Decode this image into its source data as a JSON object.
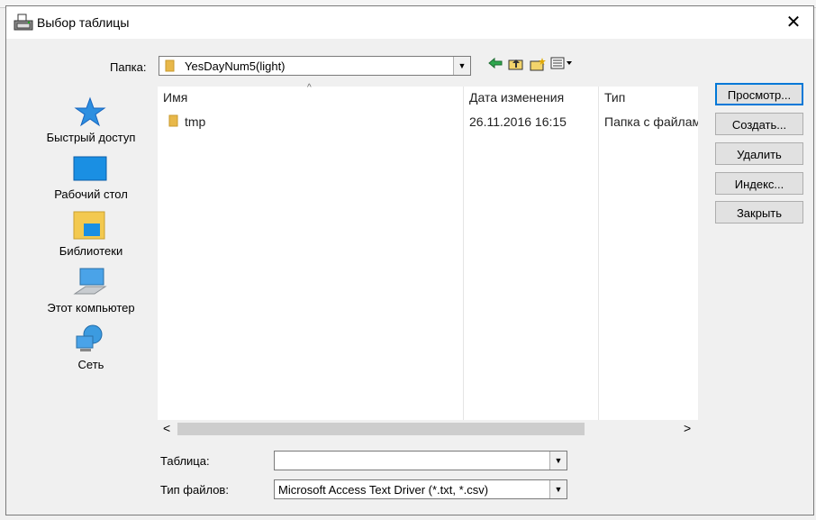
{
  "dialog": {
    "title": "Выбор таблицы",
    "close_glyph": "✕"
  },
  "location": {
    "label": "Папка:",
    "value": "YesDayNum5(light)"
  },
  "toolbar": {
    "icons": [
      "back-icon",
      "up-folder-icon",
      "new-folder-icon",
      "view-menu-icon"
    ]
  },
  "places": [
    {
      "label": "Быстрый доступ",
      "icon": "star-icon"
    },
    {
      "label": "Рабочий стол",
      "icon": "desktop-icon"
    },
    {
      "label": "Библиотеки",
      "icon": "libraries-icon"
    },
    {
      "label": "Этот компьютер",
      "icon": "computer-icon"
    },
    {
      "label": "Сеть",
      "icon": "network-icon"
    }
  ],
  "file_list": {
    "columns": [
      "Имя",
      "Дата изменения",
      "Тип"
    ],
    "rows": [
      {
        "name": "tmp",
        "date": "26.11.2016 16:15",
        "type": "Папка с файлам"
      }
    ],
    "scroll_left": "<",
    "scroll_right": ">"
  },
  "buttons": {
    "preview": "Просмотр...",
    "create": "Создать...",
    "delete": "Удалить",
    "index": "Индекс...",
    "close": "Закрыть"
  },
  "table_field": {
    "label": "Таблица:",
    "value": ""
  },
  "file_type": {
    "label": "Тип файлов:",
    "value": "Microsoft Access Text Driver (*.txt, *.csv)"
  },
  "colors": {
    "accent": "#0078d7",
    "folder": "#e8b84a"
  }
}
